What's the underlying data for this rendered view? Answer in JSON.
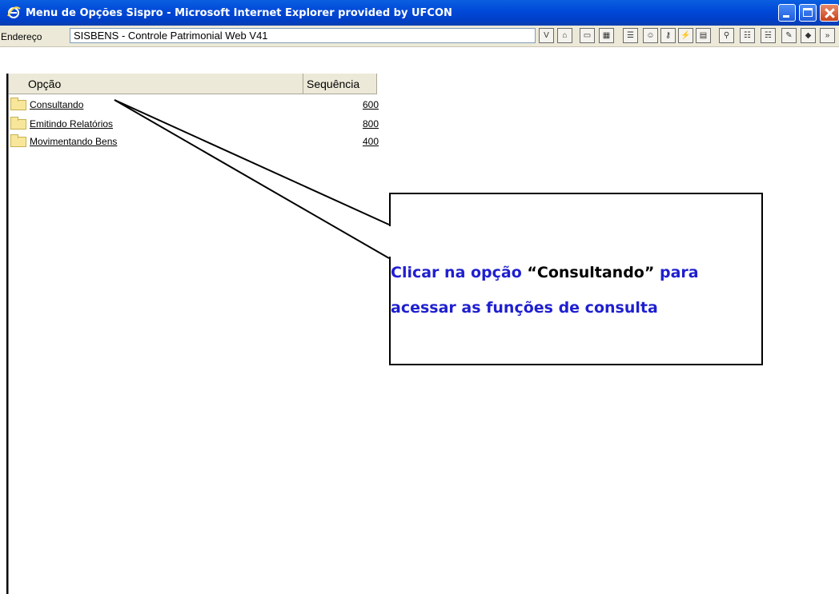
{
  "window": {
    "title": "Menu de Opções Sispro - Microsoft Internet Explorer provided by UFCON"
  },
  "address_bar": {
    "label": "Endereço",
    "value": "SISBENS - Controle Patrimonial Web V41"
  },
  "table": {
    "columns": [
      "Opção",
      "Sequência"
    ],
    "rows": [
      {
        "label": "Consultando",
        "sequence": "600"
      },
      {
        "label": "Emitindo Relatórios",
        "sequence": "800"
      },
      {
        "label": "Movimentando Bens",
        "sequence": "400"
      }
    ]
  },
  "callout": {
    "text_before": "Clicar na opção",
    "quoted": "“Consultando”",
    "text_after": "para acessar as funções de consulta"
  },
  "colors": {
    "titlebar": "#0048d8",
    "callout_text": "#1f1fd0"
  }
}
